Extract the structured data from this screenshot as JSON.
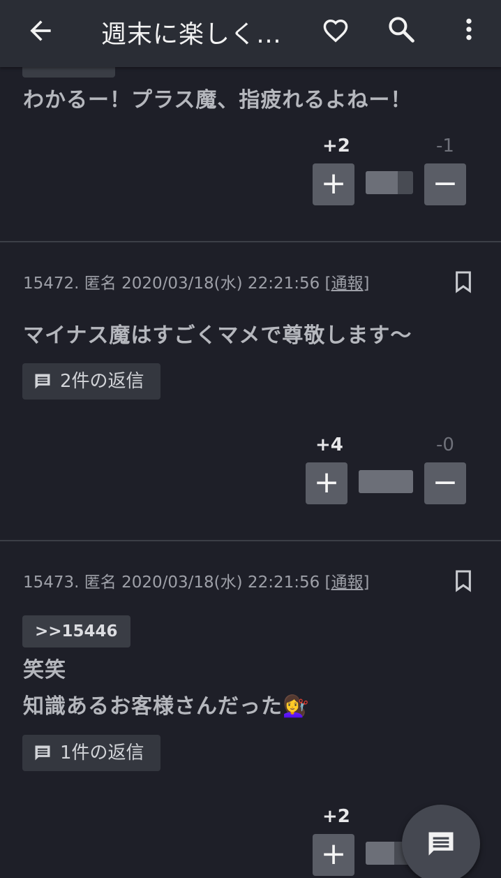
{
  "appbar": {
    "title": "週末に楽しく…",
    "back_icon": "arrow-left-icon",
    "favorite_icon": "heart-outline-icon",
    "search_icon": "search-icon",
    "more_icon": "more-vert-icon"
  },
  "posts": [
    {
      "body": "わかるー！プラス魔、指疲れるよねー！",
      "plus": "+2",
      "minus": "-1",
      "plus_share": 0.67
    },
    {
      "number": "15472.",
      "author": "匿名",
      "datetime": "2020/03/18(水) 22:21:56",
      "report_open": "[",
      "report": "通報",
      "report_close": "]",
      "body": "マイナス魔はすごくマメで尊敬します〜",
      "replies": "2件の返信",
      "plus": "+4",
      "minus": "-0",
      "plus_share": 1.0
    },
    {
      "number": "15473.",
      "author": "匿名",
      "datetime": "2020/03/18(水) 22:21:56",
      "report_open": "[",
      "report": "通報",
      "report_close": "]",
      "anchor": ">>15446",
      "body_line1": "笑笑",
      "body_line2": "知識あるお客様さんだった💇‍♀️",
      "replies": "1件の返信",
      "plus": "+2"
    }
  ],
  "vote": {
    "plus_symbol": "+",
    "minus_symbol": "−"
  },
  "fab": {
    "icon": "comment-icon"
  },
  "colors": {
    "background": "#1e1f28",
    "appbar": "#2a2d35",
    "button": "#5a5d66"
  }
}
